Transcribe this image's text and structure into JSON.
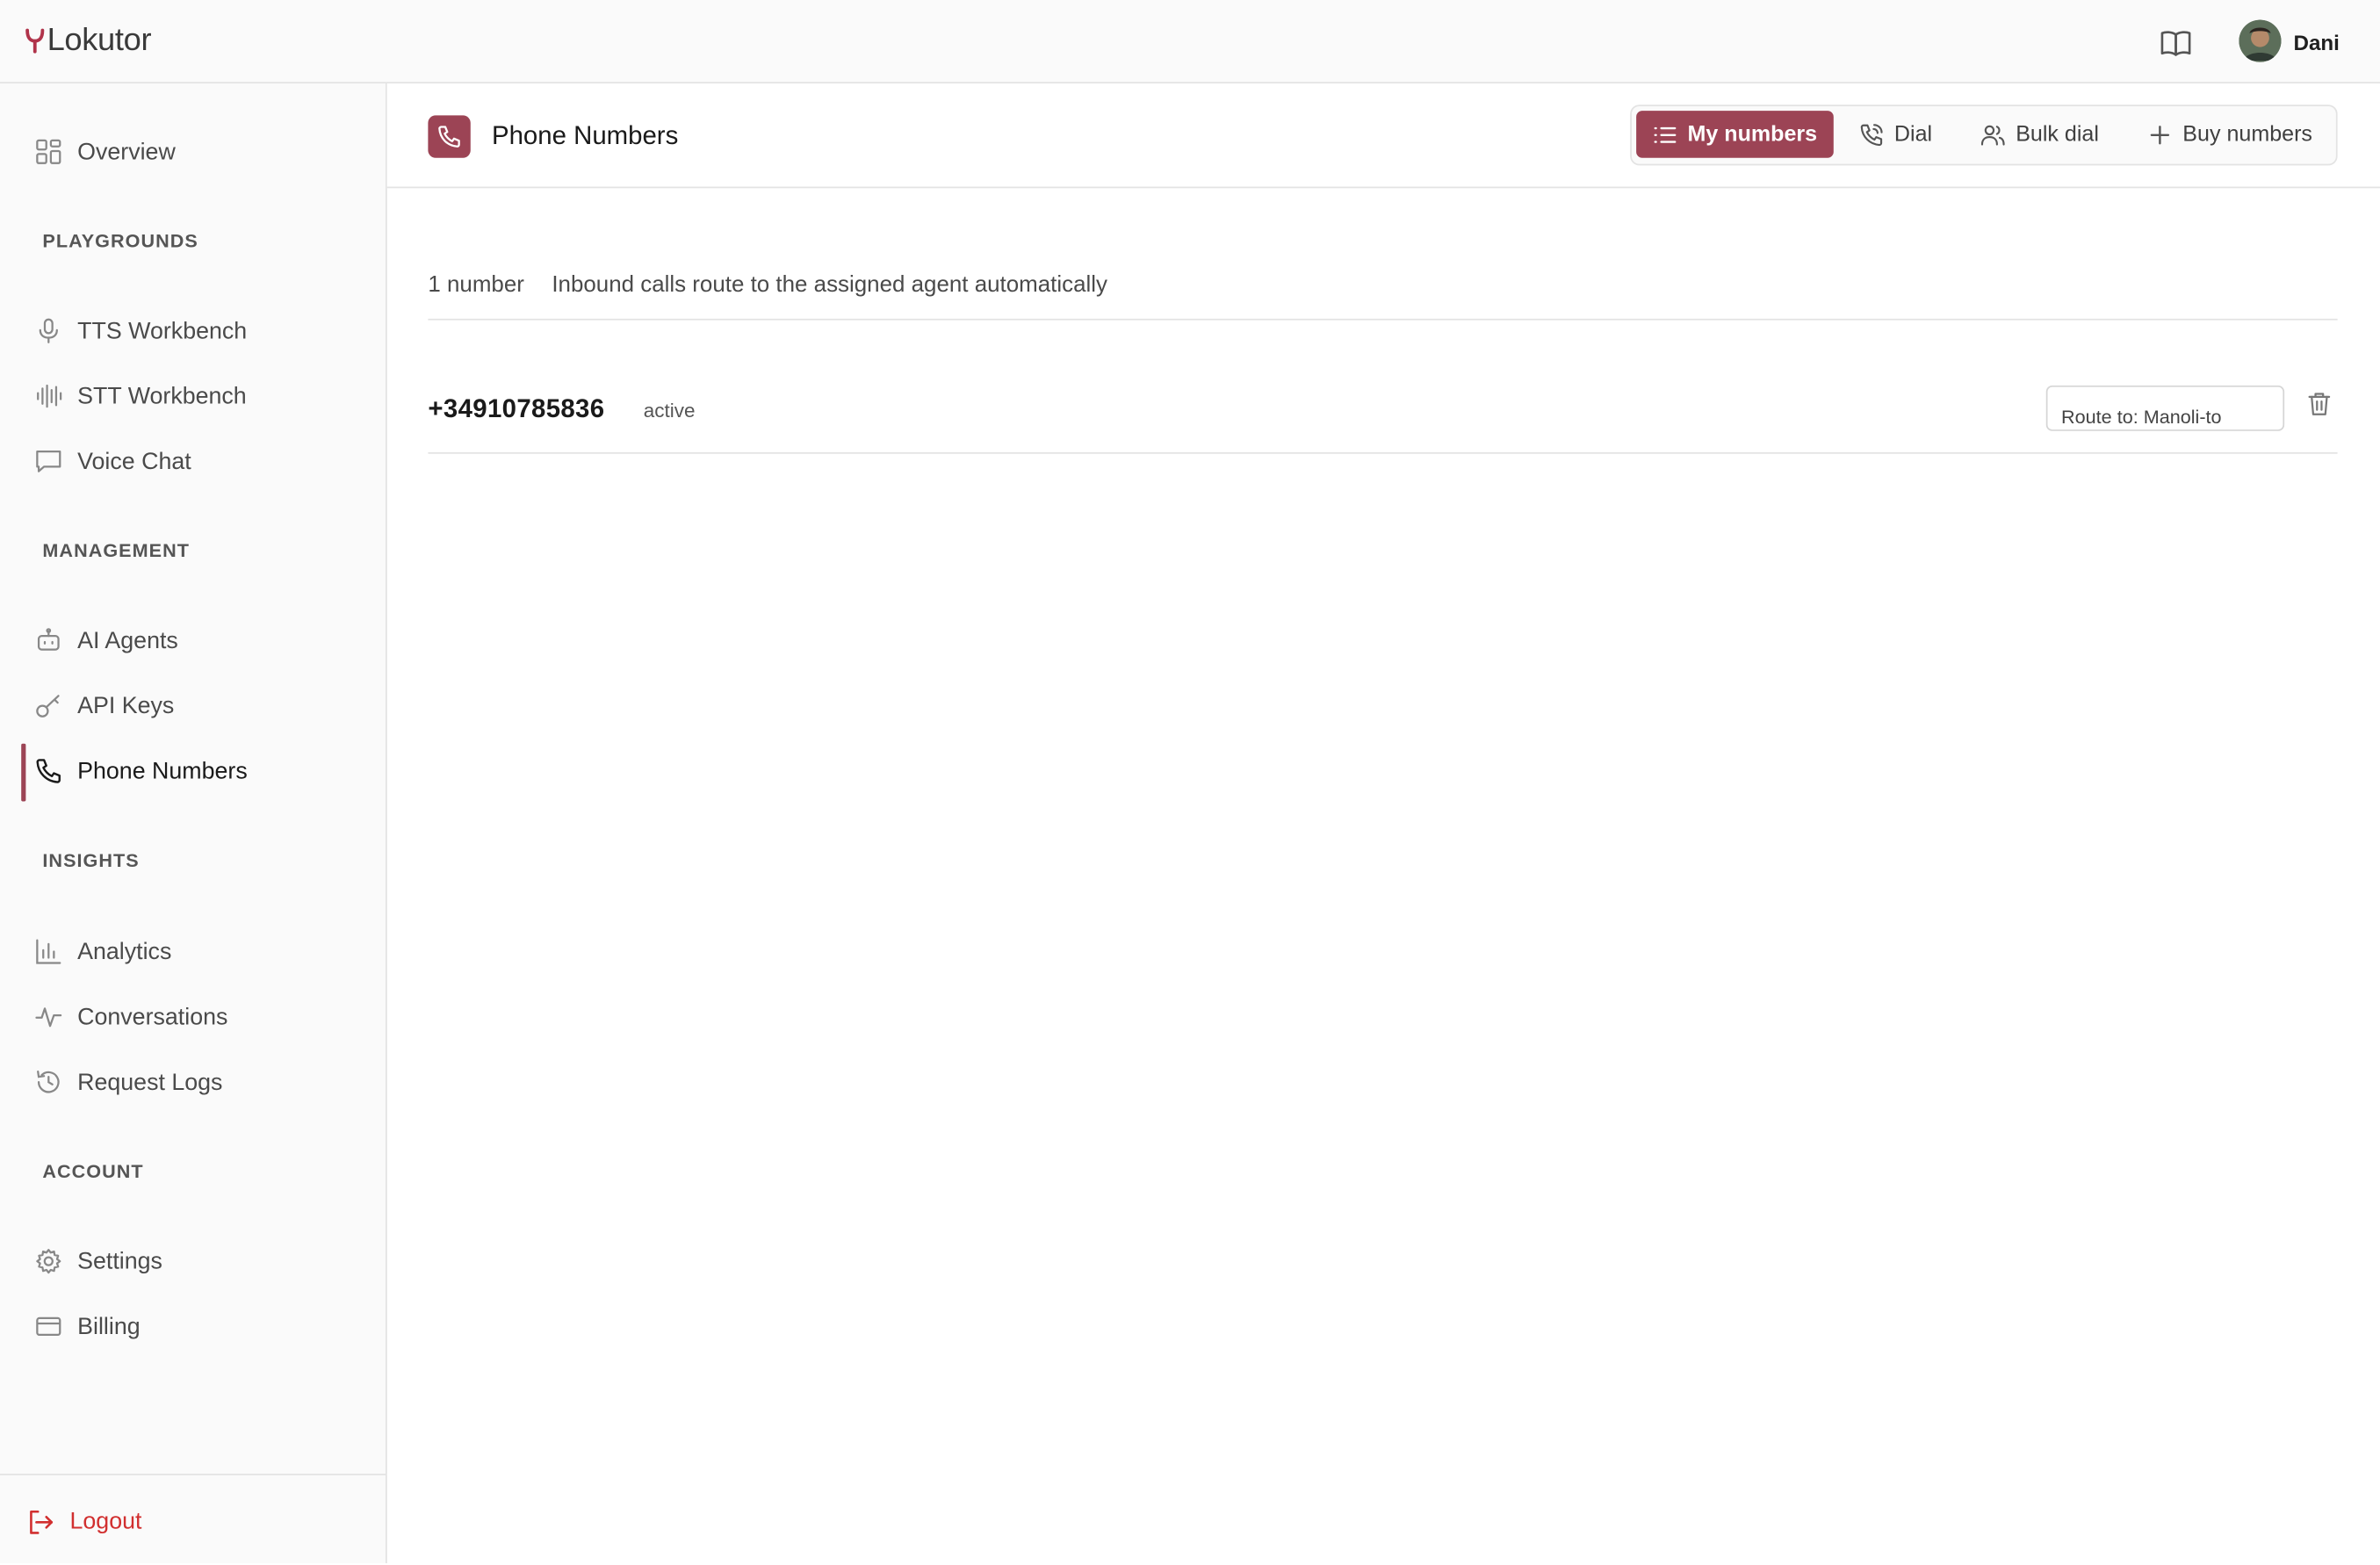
{
  "app": {
    "name": "Lokutor"
  },
  "header": {
    "user_name": "Dani",
    "docs_icon": "book-open-icon"
  },
  "sidebar": {
    "overview": {
      "label": "Overview",
      "icon": "grid-icon"
    },
    "sections": [
      {
        "title": "PLAYGROUNDS",
        "items": [
          {
            "label": "TTS Workbench",
            "icon": "microphone-icon"
          },
          {
            "label": "STT Workbench",
            "icon": "audio-waveform-icon"
          },
          {
            "label": "Voice Chat",
            "icon": "chat-bubble-icon"
          }
        ]
      },
      {
        "title": "MANAGEMENT",
        "items": [
          {
            "label": "AI Agents",
            "icon": "robot-icon"
          },
          {
            "label": "API Keys",
            "icon": "key-icon"
          },
          {
            "label": "Phone Numbers",
            "icon": "phone-icon",
            "active": true
          }
        ]
      },
      {
        "title": "INSIGHTS",
        "items": [
          {
            "label": "Analytics",
            "icon": "bar-chart-icon"
          },
          {
            "label": "Conversations",
            "icon": "activity-icon"
          },
          {
            "label": "Request Logs",
            "icon": "history-icon"
          }
        ]
      },
      {
        "title": "ACCOUNT",
        "items": [
          {
            "label": "Settings",
            "icon": "gear-icon"
          },
          {
            "label": "Billing",
            "icon": "credit-card-icon"
          }
        ]
      }
    ],
    "logout_label": "Logout"
  },
  "page": {
    "title": "Phone Numbers",
    "tabs": [
      {
        "label": "My numbers",
        "icon": "list-icon",
        "active": true
      },
      {
        "label": "Dial",
        "icon": "phone-outgoing-icon"
      },
      {
        "label": "Bulk dial",
        "icon": "users-icon"
      },
      {
        "label": "Buy numbers",
        "icon": "plus-icon"
      }
    ],
    "summary": {
      "count": "1 number",
      "description": "Inbound calls route to the assigned agent automatically"
    },
    "numbers": [
      {
        "number": "+34910785836",
        "status": "active",
        "route": "Route to: Manoli-to"
      }
    ]
  },
  "colors": {
    "accent": "#9c4455",
    "logout": "#d12f2f",
    "sidebar_bg": "#fafafa",
    "border": "#e3e3e3"
  }
}
